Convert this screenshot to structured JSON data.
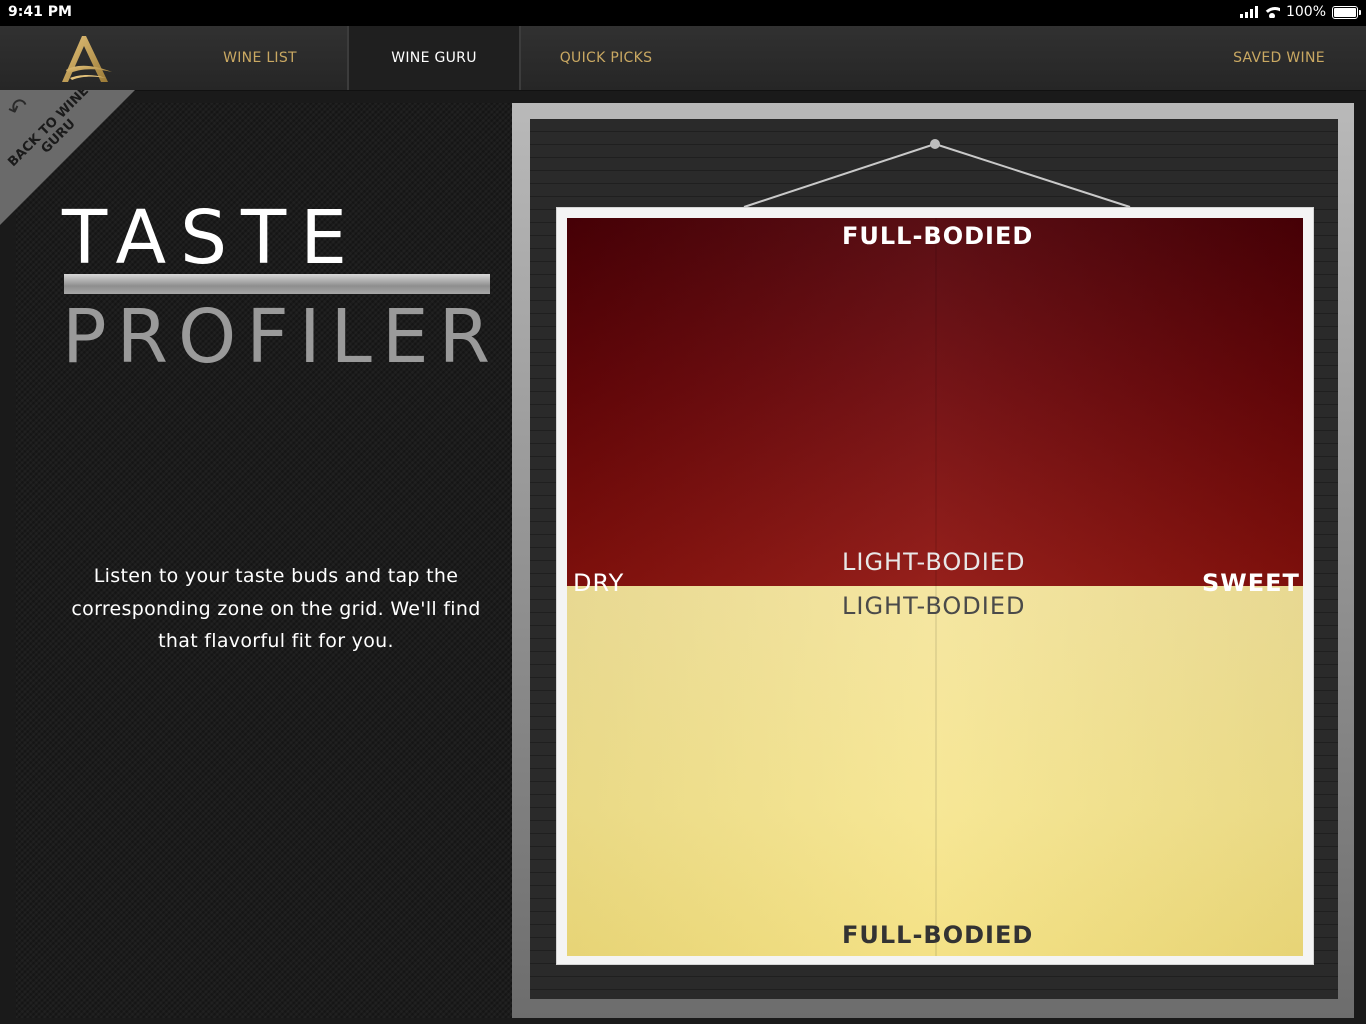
{
  "status": {
    "time": "9:41 PM",
    "battery": "100%"
  },
  "nav": {
    "items": [
      {
        "label": "WINE LIST"
      },
      {
        "label": "WINE GURU"
      },
      {
        "label": "QUICK PICKS"
      },
      {
        "label": "SAVED WINE"
      }
    ],
    "active": "WINE GURU"
  },
  "back_link": {
    "label": "BACK TO WINE GURU"
  },
  "title": {
    "line1": "TASTE",
    "line2": "PROFILER"
  },
  "intro_text": "Listen to your taste buds and tap the corresponding zone on the grid. We'll find that flavorful fit for you.",
  "grid": {
    "top_label": "FULL-BODIED",
    "center_top_label": "LIGHT-BODIED",
    "center_bottom_label": "LIGHT-BODIED",
    "bottom_label": "FULL-BODIED",
    "left_label": "DRY",
    "right_label": "SWEET",
    "colors": {
      "red_zone": "#6c0609",
      "yellow_zone": "#f6e58d"
    }
  }
}
